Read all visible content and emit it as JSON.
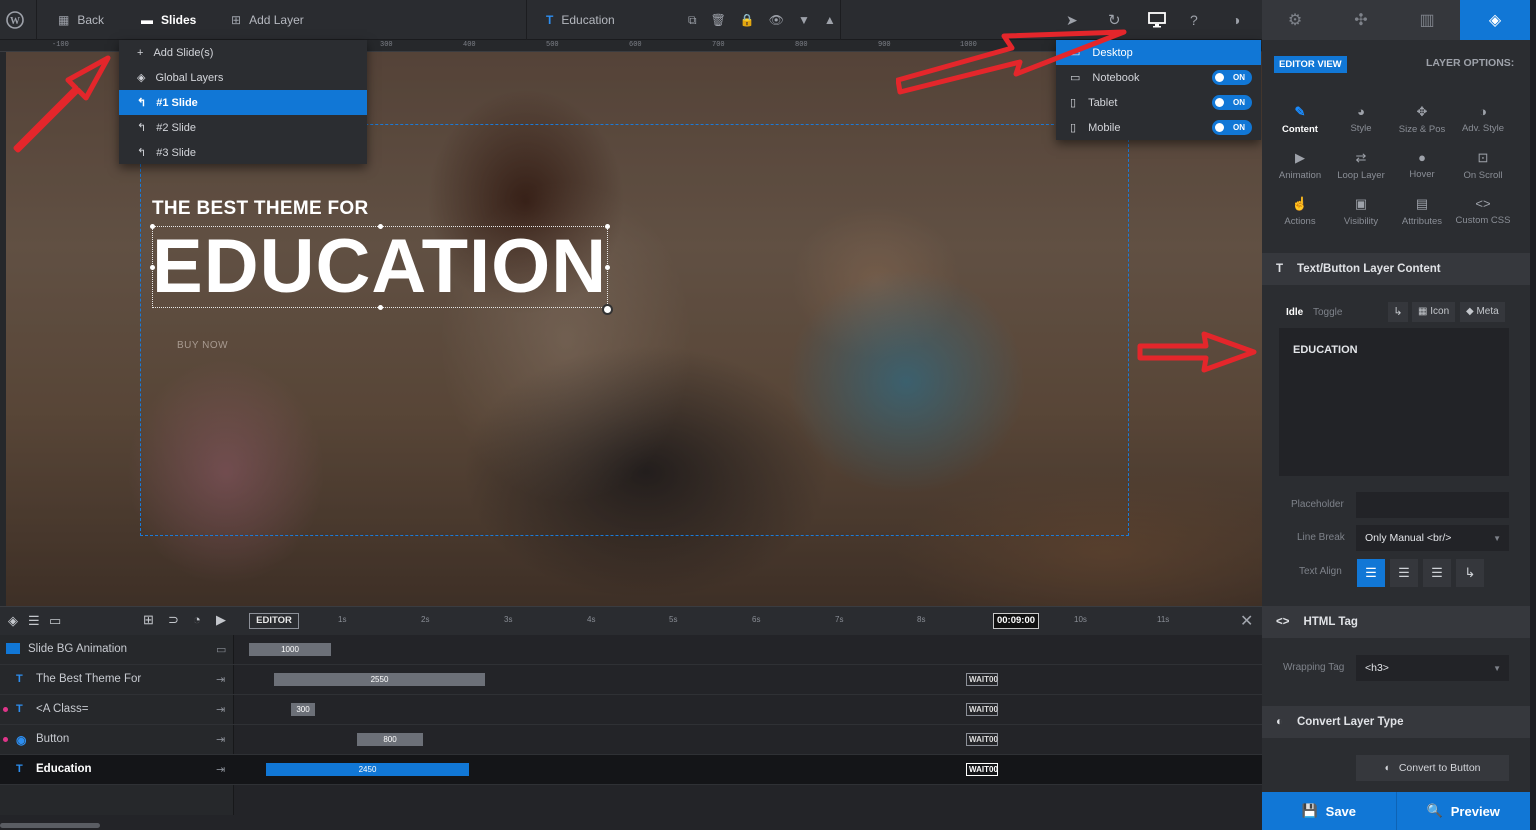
{
  "topbar": {
    "back": "Back",
    "slides": "Slides",
    "add_layer": "Add Layer",
    "layer_name": "Education"
  },
  "ruler": [
    "-100",
    "100",
    "300",
    "400",
    "500",
    "600",
    "700",
    "800",
    "900",
    "1000"
  ],
  "slides_menu": {
    "items": [
      {
        "label": "Add Slide(s)",
        "icon": "plus-icon"
      },
      {
        "label": "Global Layers",
        "icon": "layers-icon"
      },
      {
        "label": "#1 Slide",
        "icon": "slide-icon",
        "selected": true
      },
      {
        "label": "#2 Slide",
        "icon": "slide-icon"
      },
      {
        "label": "#3 Slide",
        "icon": "slide-icon"
      }
    ]
  },
  "device_menu": {
    "items": [
      {
        "label": "Desktop",
        "toggle": ""
      },
      {
        "label": "Notebook",
        "toggle": "ON"
      },
      {
        "label": "Tablet",
        "toggle": "ON"
      },
      {
        "label": "Mobile",
        "toggle": "ON"
      }
    ]
  },
  "canvas": {
    "subtitle": "THE BEST THEME FOR",
    "title": "EDUCATION",
    "button": "BUY NOW"
  },
  "timeline": {
    "editor_label": "EDITOR",
    "ticks": [
      "1s",
      "2s",
      "3s",
      "4s",
      "5s",
      "6s",
      "7s",
      "8s",
      "10s",
      "11s"
    ],
    "time": "00:09:00",
    "rows": [
      {
        "name": "Slide BG Animation",
        "bar": "1000"
      },
      {
        "name": "The Best Theme For",
        "bar": "2550",
        "wait": "WAIT",
        "wait_val": "00"
      },
      {
        "name": "<A Class=",
        "bar": "300",
        "wait": "WAIT",
        "wait_val": "00"
      },
      {
        "name": "Button",
        "bar": "800",
        "wait": "WAIT",
        "wait_val": "00"
      },
      {
        "name": "Education",
        "bar": "2450",
        "wait": "WAIT",
        "wait_val": "00"
      }
    ]
  },
  "panel": {
    "editor_view": "EDITOR VIEW",
    "layer_options": "LAYER OPTIONS:",
    "options": [
      "Content",
      "Style",
      "Size & Pos",
      "Adv. Style",
      "Animation",
      "Loop Layer",
      "Hover",
      "On Scroll",
      "Actions",
      "Visibility",
      "Attributes",
      "Custom CSS"
    ],
    "section_content": "Text/Button Layer Content",
    "idle": "Idle",
    "toggle": "Toggle",
    "icon": "Icon",
    "meta": "Meta",
    "content_text": "EDUCATION",
    "placeholder_label": "Placeholder",
    "line_break_label": "Line Break",
    "line_break_value": "Only Manual <br/>",
    "text_align_label": "Text Align",
    "section_html": "HTML Tag",
    "wrapping_label": "Wrapping Tag",
    "wrapping_value": "<h3>",
    "section_convert": "Convert Layer Type",
    "convert_button": "Convert to Button",
    "save": "Save",
    "preview": "Preview"
  },
  "colors": {
    "accent": "#1177d6",
    "arrow": "#e4262b"
  }
}
